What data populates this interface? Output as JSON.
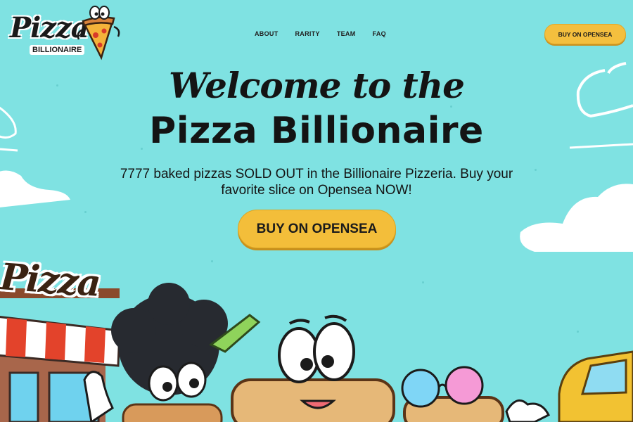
{
  "logo": {
    "wordmark": "Pizza",
    "subtitle": "BILLIONAIRE",
    "slice_icon": "pizza-slice-mascot-icon"
  },
  "nav": {
    "items": [
      {
        "label": "ABOUT"
      },
      {
        "label": "RARITY"
      },
      {
        "label": "TEAM"
      },
      {
        "label": "FAQ"
      }
    ]
  },
  "header_cta": {
    "label": "BUY ON OPENSEA"
  },
  "hero": {
    "welcome": "Welcome to the",
    "title": "Pizza Billionaire",
    "description": "7777 baked pizzas SOLD OUT in the Billionaire Pizzeria. Buy your favorite slice on Opensea NOW!",
    "cta_label": "BUY ON OPENSEA"
  },
  "illustration": {
    "shop_sign": "Pizza"
  },
  "colors": {
    "background": "#7fe2e2",
    "button": "#f3be3a",
    "text": "#141414"
  }
}
